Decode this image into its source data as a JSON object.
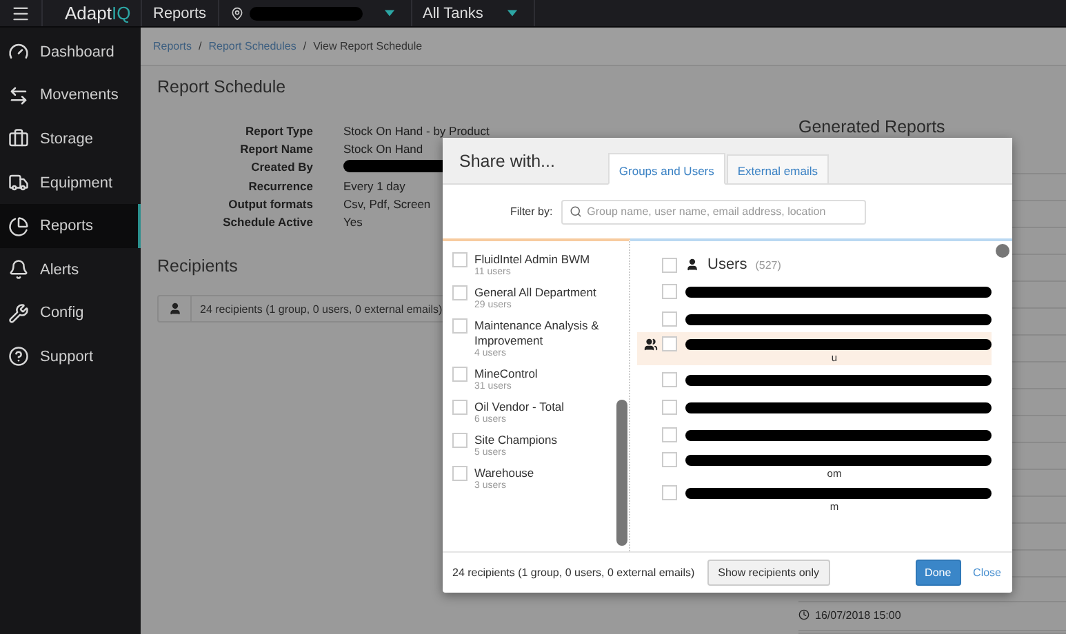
{
  "topbar": {
    "logo": {
      "text": "Adapt",
      "accent": "IQ"
    },
    "section": "Reports",
    "tanks": "All Tanks"
  },
  "sidebar": {
    "items": [
      {
        "label": "Dashboard",
        "selected": false
      },
      {
        "label": "Movements",
        "selected": false
      },
      {
        "label": "Storage",
        "selected": false
      },
      {
        "label": "Equipment",
        "selected": false
      },
      {
        "label": "Reports",
        "selected": true
      },
      {
        "label": "Alerts",
        "selected": false
      },
      {
        "label": "Config",
        "selected": false
      },
      {
        "label": "Support",
        "selected": false
      }
    ]
  },
  "breadcrumb": {
    "separator": "/",
    "items": [
      "Reports",
      "Report Schedules",
      "View Report Schedule"
    ]
  },
  "schedule": {
    "title": "Report Schedule",
    "fields": [
      {
        "label": "Report Type",
        "kind": "text",
        "value": "Stock On Hand - by Product"
      },
      {
        "label": "Report Name",
        "kind": "text",
        "value": "Stock On Hand"
      },
      {
        "label": "Created By",
        "kind": "redacted"
      },
      {
        "label": "Recurrence",
        "kind": "text",
        "value": "Every 1 day"
      },
      {
        "label": "Output formats",
        "kind": "text",
        "value": "Csv, Pdf, Screen"
      },
      {
        "label": "Schedule Active",
        "kind": "text",
        "value": "Yes"
      }
    ]
  },
  "recipients": {
    "title": "Recipients",
    "summary": "24 recipients (1 group, 0 users, 0 external emails)"
  },
  "generated_reports": {
    "title": "Generated Reports",
    "rows": [
      {
        "date": "16/07/2018 15:00"
      }
    ]
  },
  "dialog": {
    "title": "Share with...",
    "tabs": [
      {
        "label": "Groups and Users",
        "selected": true
      },
      {
        "label": "External emails",
        "selected": false
      }
    ],
    "filter_label": "Filter by:",
    "filter_placeholder": "Group name, user name, email address, location",
    "groups": [
      {
        "name": "FluidIntel Admin BWM",
        "count": "11 users",
        "checked": false
      },
      {
        "name": "General All Department",
        "count": "29 users",
        "checked": false
      },
      {
        "name": "Maintenance Analysis & Improvement",
        "count": "4 users",
        "checked": false
      },
      {
        "name": "MineControl",
        "count": "31 users",
        "checked": false
      },
      {
        "name": "Oil Vendor - Total",
        "count": "6 users",
        "checked": false
      },
      {
        "name": "Site Champions",
        "count": "5 users",
        "checked": false
      },
      {
        "name": "Warehouse",
        "count": "3 users",
        "checked": false
      }
    ],
    "users_header": {
      "label": "Users",
      "count": "(527)",
      "checked": false
    },
    "users": [
      {
        "highlighted": false,
        "checked": false
      },
      {
        "highlighted": false,
        "checked": false
      },
      {
        "highlighted": true,
        "checked": false,
        "suffix": "u"
      },
      {
        "highlighted": false,
        "checked": false
      },
      {
        "highlighted": false,
        "checked": false
      },
      {
        "highlighted": false,
        "checked": false
      },
      {
        "highlighted": false,
        "checked": false,
        "suffix": "om"
      },
      {
        "highlighted": false,
        "checked": false,
        "suffix": "m"
      }
    ],
    "footer": {
      "summary": "24 recipients (1 group, 0 users, 0 external emails)",
      "show_button": "Show recipients only",
      "done": "Done",
      "close": "Close"
    }
  }
}
